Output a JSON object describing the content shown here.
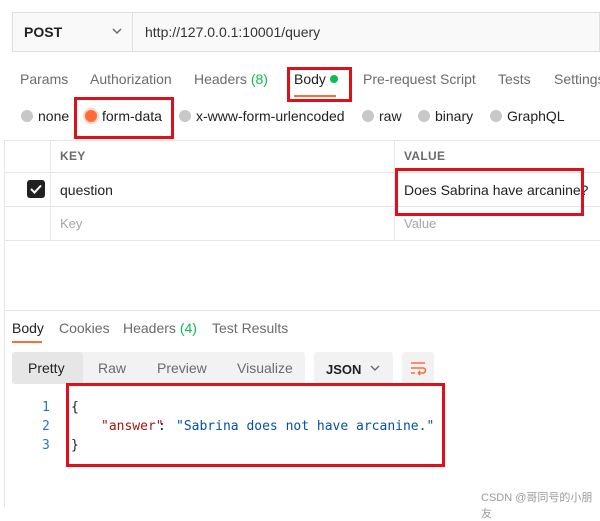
{
  "request": {
    "method": "POST",
    "url": "http://127.0.0.1:10001/query"
  },
  "request_tabs": {
    "params": "Params",
    "authorization": "Authorization",
    "headers": "Headers",
    "headers_count": "(8)",
    "body": "Body",
    "prerequest": "Pre-request Script",
    "tests": "Tests",
    "settings": "Settings"
  },
  "body_types": {
    "none": "none",
    "form_data": "form-data",
    "urlencoded": "x-www-form-urlencoded",
    "raw": "raw",
    "binary": "binary",
    "graphql": "GraphQL",
    "selected": "form-data"
  },
  "form_table": {
    "header_key": "KEY",
    "header_value": "VALUE",
    "rows": [
      {
        "key": "question",
        "value": "Does Sabrina have arcanine?",
        "checked": true
      }
    ],
    "placeholder_key": "Key",
    "placeholder_value": "Value"
  },
  "response_tabs": {
    "body": "Body",
    "cookies": "Cookies",
    "headers": "Headers",
    "headers_count": "(4)",
    "test_results": "Test Results"
  },
  "view_modes": {
    "pretty": "Pretty",
    "raw": "Raw",
    "preview": "Preview",
    "visualize": "Visualize",
    "format": "JSON"
  },
  "response_body": {
    "lines": [
      "1",
      "2",
      "3"
    ],
    "open_brace": "{",
    "key": "\"answer\"",
    "colon": ":",
    "value": "\"Sabrina does not have arcanine.\"",
    "close_brace": "}"
  },
  "watermark": "CSDN @哥同号的小朋友",
  "colors": {
    "accent": "#ff6c37",
    "highlight_box": "#e0101a",
    "status_green": "#0cbb52"
  }
}
